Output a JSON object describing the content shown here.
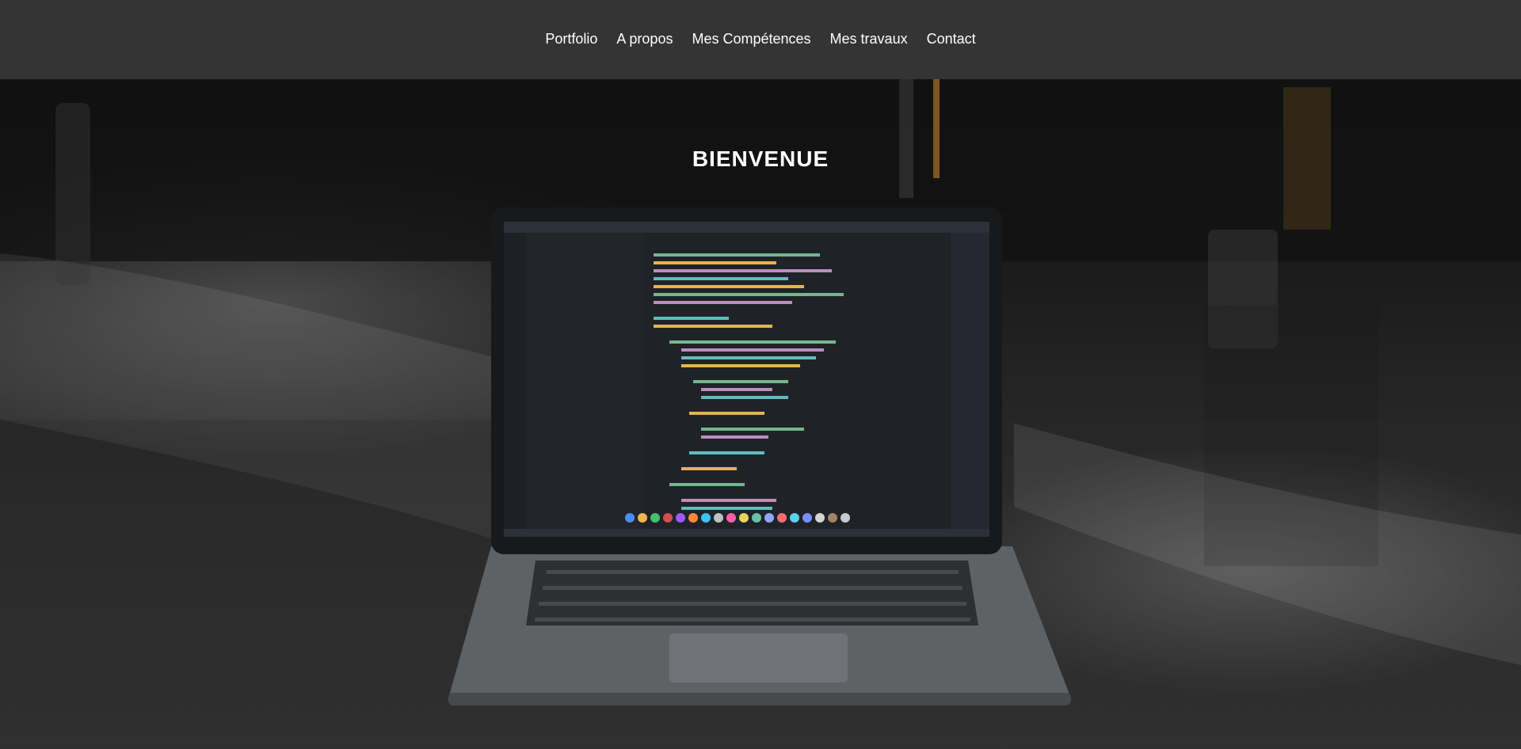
{
  "nav": {
    "items": [
      {
        "label": "Portfolio"
      },
      {
        "label": "A propos"
      },
      {
        "label": "Mes Compétences"
      },
      {
        "label": "Mes travaux"
      },
      {
        "label": "Contact"
      }
    ]
  },
  "hero": {
    "title": "BIENVENUE"
  }
}
